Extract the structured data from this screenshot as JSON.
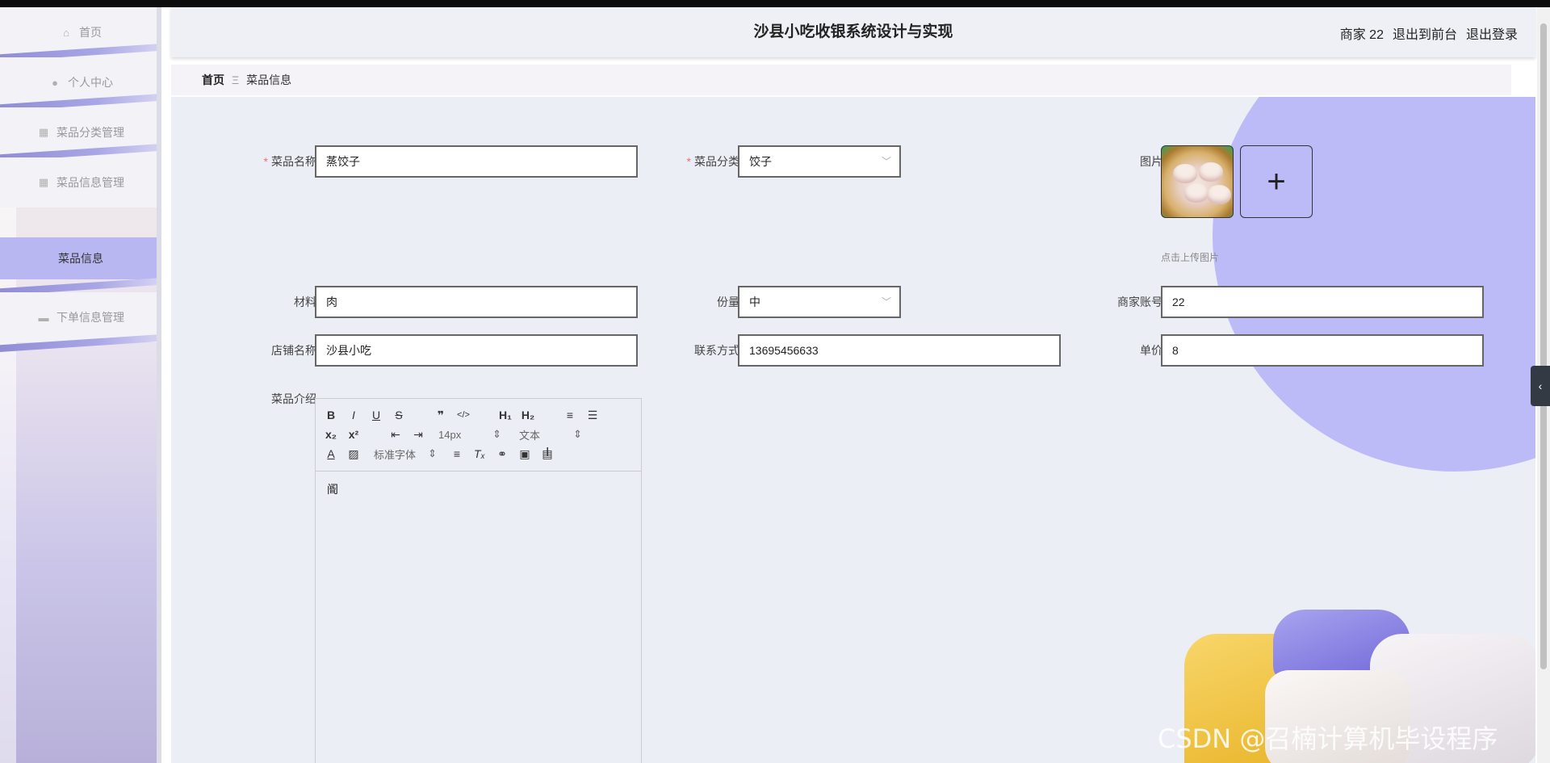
{
  "sidebar": {
    "items": [
      {
        "label": "首页",
        "icon": "home-icon"
      },
      {
        "label": "个人中心",
        "icon": "user-icon"
      },
      {
        "label": "菜品分类管理",
        "icon": "grid-icon"
      },
      {
        "label": "菜品信息管理",
        "icon": "grid-icon"
      },
      {
        "label": "菜品信息",
        "active": true
      },
      {
        "label": "下单信息管理",
        "icon": "chat-icon"
      }
    ]
  },
  "header": {
    "title": "沙县小吃收银系统设计与实现",
    "user": "商家 22",
    "to_front": "退出到前台",
    "logout": "退出登录"
  },
  "breadcrumb": {
    "home": "首页",
    "separator": "Ξ",
    "current": "菜品信息"
  },
  "form": {
    "dish_name": {
      "label": "菜品名称",
      "value": "蒸饺子",
      "required": true
    },
    "category": {
      "label": "菜品分类",
      "value": "饺子",
      "required": true
    },
    "image": {
      "label": "图片",
      "tip": "点击上传图片"
    },
    "material": {
      "label": "材料",
      "value": "肉"
    },
    "portion": {
      "label": "份量",
      "value": "中"
    },
    "merchant_account": {
      "label": "商家账号",
      "value": "22"
    },
    "shop_name": {
      "label": "店铺名称",
      "value": "沙县小吃"
    },
    "contact": {
      "label": "联系方式",
      "value": "13695456633"
    },
    "unit_price": {
      "label": "单价",
      "value": "8"
    },
    "intro": {
      "label": "菜品介绍",
      "content": "阍"
    }
  },
  "editor": {
    "font_size": "14px",
    "header_select": "文本",
    "font_family": "标准字体"
  },
  "watermark": "CSDN @召楠计算机毕设程序",
  "colors": {
    "accent": "#bcbaf7",
    "active_menu": "#b9b7f2",
    "required": "#f56c6c"
  }
}
